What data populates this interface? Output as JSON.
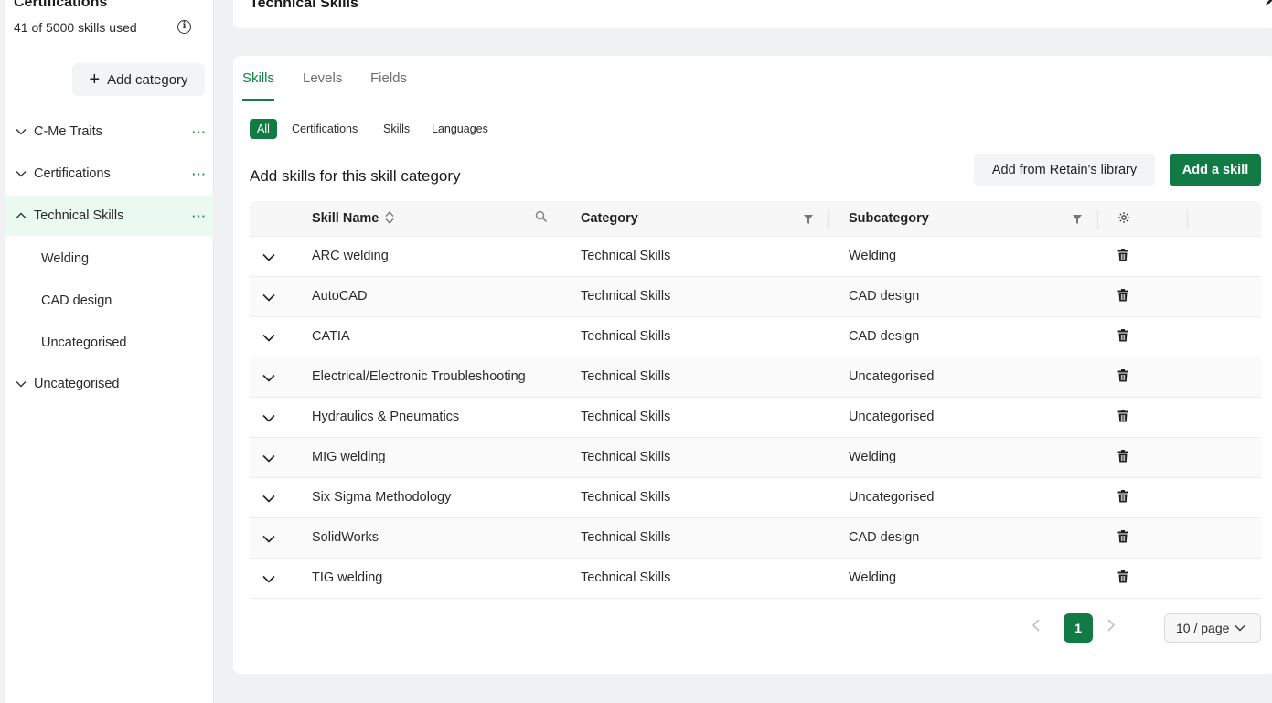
{
  "sidebar": {
    "title": "Certifications",
    "usage": "41 of 5000 skills used",
    "info_icon_label": "i",
    "add_category_label": "Add category",
    "categories": [
      {
        "label": "C-Me Traits",
        "expanded": false,
        "more": "···"
      },
      {
        "label": "Certifications",
        "expanded": false,
        "more": "···"
      },
      {
        "label": "Technical Skills",
        "expanded": true,
        "active": true,
        "more": "···"
      }
    ],
    "subcategories": [
      "Welding",
      "CAD design",
      "Uncategorised"
    ],
    "uncategorised": "Uncategorised"
  },
  "header": {
    "title": "Technical Skills",
    "edit_icon": "pencil-icon"
  },
  "tabs": [
    {
      "label": "Skills",
      "active": true
    },
    {
      "label": "Levels",
      "active": false
    },
    {
      "label": "Fields",
      "active": false
    }
  ],
  "filters": [
    {
      "label": "All",
      "active": true
    },
    {
      "label": "Certifications",
      "active": false
    },
    {
      "label": "Skills",
      "active": false
    },
    {
      "label": "Languages",
      "active": false
    }
  ],
  "section_title": "Add skills for this skill category",
  "buttons": {
    "library": "Add from Retain's library",
    "add_skill": "Add a skill"
  },
  "table": {
    "columns": {
      "skill_name": "Skill Name",
      "category": "Category",
      "subcategory": "Subcategory"
    },
    "rows": [
      {
        "name": "ARC welding",
        "category": "Technical Skills",
        "subcategory": "Welding"
      },
      {
        "name": "AutoCAD",
        "category": "Technical Skills",
        "subcategory": "CAD design"
      },
      {
        "name": "CATIA",
        "category": "Technical Skills",
        "subcategory": "CAD design"
      },
      {
        "name": "Electrical/Electronic Troubleshooting",
        "category": "Technical Skills",
        "subcategory": "Uncategorised"
      },
      {
        "name": "Hydraulics & Pneumatics",
        "category": "Technical Skills",
        "subcategory": "Uncategorised"
      },
      {
        "name": "MIG welding",
        "category": "Technical Skills",
        "subcategory": "Welding"
      },
      {
        "name": "Six Sigma Methodology",
        "category": "Technical Skills",
        "subcategory": "Uncategorised"
      },
      {
        "name": "SolidWorks",
        "category": "Technical Skills",
        "subcategory": "CAD design"
      },
      {
        "name": "TIG welding",
        "category": "Technical Skills",
        "subcategory": "Welding"
      }
    ]
  },
  "pagination": {
    "current_page": "1",
    "page_size": "10 / page"
  },
  "colors": {
    "accent": "#127a44",
    "active_row": "#eafaf0"
  }
}
